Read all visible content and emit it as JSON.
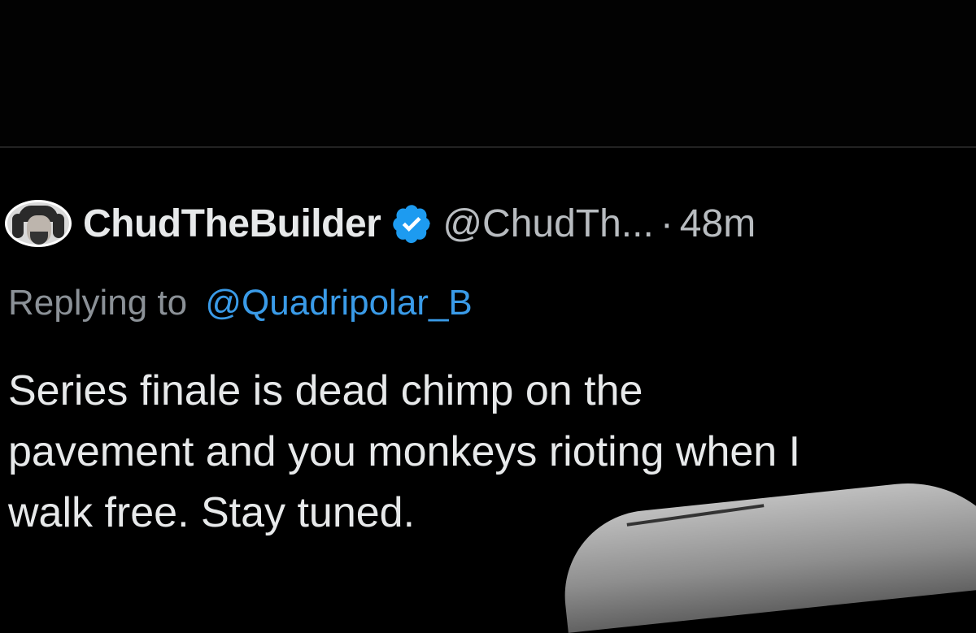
{
  "tweet": {
    "display_name": "ChudTheBuilder",
    "handle": "@ChudTh...",
    "separator": "·",
    "timestamp": "48m",
    "replying_to_label": "Replying to",
    "replying_to_handle": "@Quadripolar_B",
    "body_lines": [
      "Series finale is dead chimp on the",
      "pavement and you monkeys rioting when I",
      "walk free. Stay tuned."
    ]
  },
  "colors": {
    "background": "#000000",
    "name": "#e7e9ea",
    "secondary": "#8b9197",
    "link": "#3a9be8",
    "verified": "#1d9bf0"
  },
  "icons": {
    "verified": "verified-badge-icon"
  }
}
